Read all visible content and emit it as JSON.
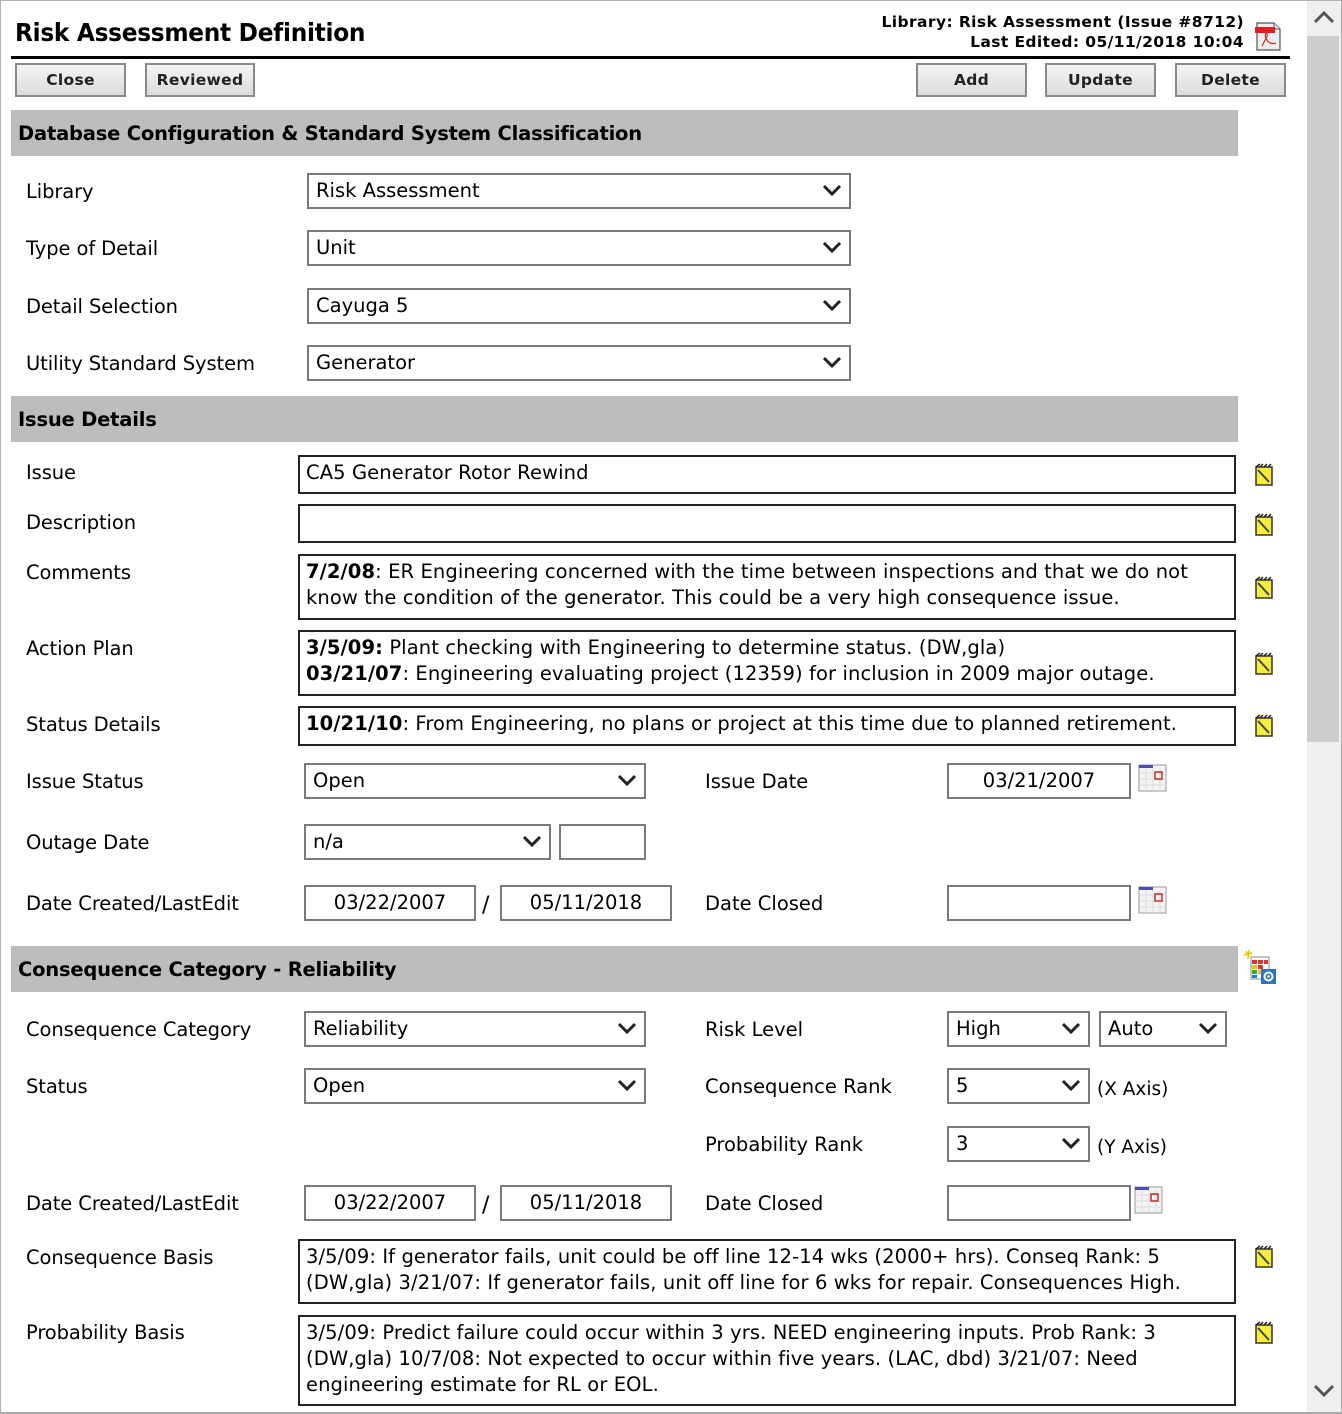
{
  "header": {
    "title": "Risk Assessment Definition",
    "library_line": "Library: Risk Assessment (Issue #8712)",
    "last_edited_line": "Last Edited: 05/11/2018 10:04",
    "pdf_icon": "pdf-export-icon"
  },
  "toolbar": {
    "close_label": "Close",
    "reviewed_label": "Reviewed",
    "add_label": "Add",
    "update_label": "Update",
    "delete_label": "Delete"
  },
  "db_config": {
    "section_title": "Database Configuration & Standard System Classification",
    "library": {
      "label": "Library",
      "value": "Risk Assessment"
    },
    "type_of_detail": {
      "label": "Type of Detail",
      "value": "Unit"
    },
    "detail_selection": {
      "label": "Detail Selection",
      "value": "Cayuga 5"
    },
    "utility_standard_system": {
      "label": "Utility Standard System",
      "value": "Generator"
    }
  },
  "issue_details": {
    "section_title": "Issue Details",
    "issue": {
      "label": "Issue",
      "value": "CA5 Generator Rotor Rewind"
    },
    "description": {
      "label": "Description",
      "value": ""
    },
    "comments": {
      "label": "Comments",
      "date": "7/2/08",
      "text": ": ER Engineering concerned with the time between inspections and that we do not know the condition of the generator. This could be a very high consequence issue."
    },
    "action_plan": {
      "label": "Action Plan",
      "entries": [
        {
          "date": "3/5/09:",
          "text": " Plant checking with Engineering to determine status. (DW,gla)"
        },
        {
          "date": "03/21/07",
          "text": ": Engineering evaluating project (12359) for inclusion in 2009 major outage."
        }
      ]
    },
    "status_details": {
      "label": "Status Details",
      "date": "10/21/10",
      "text": ": From Engineering, no plans or project at this time due to planned retirement."
    },
    "issue_status": {
      "label": "Issue Status",
      "value": "Open"
    },
    "issue_date": {
      "label": "Issue Date",
      "value": "03/21/2007"
    },
    "outage_date": {
      "label": "Outage Date",
      "value": "n/a",
      "extra_value": ""
    },
    "date_created_lastedit": {
      "label": "Date Created/LastEdit",
      "created": "03/22/2007",
      "separator": "/",
      "last_edit": "05/11/2018"
    },
    "date_closed": {
      "label": "Date Closed",
      "value": ""
    }
  },
  "consequence": {
    "section_title": "Consequence Category - Reliability",
    "section_icon": "risk-matrix-settings-icon",
    "category": {
      "label": "Consequence Category",
      "value": "Reliability"
    },
    "status": {
      "label": "Status",
      "value": "Open"
    },
    "risk_level": {
      "label": "Risk Level",
      "value": "High",
      "mode": "Auto"
    },
    "consequence_rank": {
      "label": "Consequence Rank",
      "value": "5",
      "axis_note": "(X Axis)"
    },
    "probability_rank": {
      "label": "Probability Rank",
      "value": "3",
      "axis_note": "(Y Axis)"
    },
    "date_created_lastedit": {
      "label": "Date Created/LastEdit",
      "created": "03/22/2007",
      "separator": "/",
      "last_edit": "05/11/2018"
    },
    "date_closed": {
      "label": "Date Closed",
      "value": ""
    },
    "consequence_basis": {
      "label": "Consequence Basis",
      "text": "3/5/09: If generator fails, unit could be off line 12-14 wks (2000+ hrs).  Conseq Rank: 5 (DW,gla) 3/21/07: If generator fails, unit off line for 6 wks for repair.  Consequences High."
    },
    "probability_basis": {
      "label": "Probability Basis",
      "text": "3/5/09: Predict failure could occur within 3 yrs. NEED engineering inputs.  Prob Rank: 3 (DW,gla)  10/7/08: Not expected to occur within five years. (LAC, dbd) 3/21/07: Need engineering estimate for RL or EOL."
    }
  }
}
